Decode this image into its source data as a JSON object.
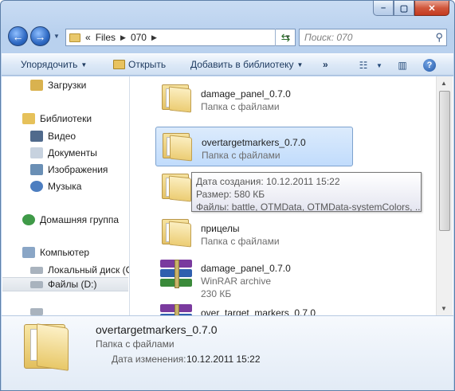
{
  "nav": {
    "breadcrumb_prefix": "«",
    "breadcrumb": [
      "Files",
      "070"
    ],
    "search_placeholder": "Поиск: 070"
  },
  "toolbar": {
    "organize": "Упорядочить",
    "open": "Открыть",
    "add_to_library": "Добавить в библиотеку",
    "more": "»"
  },
  "sidebar": {
    "items": [
      {
        "label": "Загрузки",
        "icon": "downloads-icon"
      },
      {
        "label": "Библиотеки",
        "icon": "libraries-icon"
      },
      {
        "label": "Видео",
        "icon": "video-icon"
      },
      {
        "label": "Документы",
        "icon": "documents-icon"
      },
      {
        "label": "Изображения",
        "icon": "pictures-icon"
      },
      {
        "label": "Музыка",
        "icon": "music-icon"
      },
      {
        "label": "Домашняя группа",
        "icon": "homegroup-icon"
      },
      {
        "label": "Компьютер",
        "icon": "computer-icon"
      },
      {
        "label": "Локальный диск (C",
        "icon": "drive-c-icon"
      },
      {
        "label": "Файлы (D:)",
        "icon": "drive-d-icon"
      }
    ]
  },
  "files": [
    {
      "name": "damage_panel_0.7.0",
      "type": "Папка с файлами",
      "size": ""
    },
    {
      "name": "overtargetmarkers_0.7.0",
      "type": "Папка с файлами",
      "size": ""
    },
    {
      "name": "",
      "type": "",
      "size": ""
    },
    {
      "name": "прицелы",
      "type": "Папка с файлами",
      "size": ""
    },
    {
      "name": "damage_panel_0.7.0",
      "type": "WinRAR archive",
      "size": "230 КБ"
    },
    {
      "name": "over_target_markers_0.7.0",
      "type": "",
      "size": ""
    }
  ],
  "tooltip": {
    "line1": "Дата создания: 10.12.2011 15:22",
    "line2": "Размер: 580 КБ",
    "line3": "Файлы: battle, OTMData, OTMData-systemColors, ..."
  },
  "details": {
    "name": "overtargetmarkers_0.7.0",
    "type": "Папка с файлами",
    "modified_label": "Дата изменения:",
    "modified_value": "10.12.2011 15:22"
  },
  "colors": {
    "selection_bg": "#c1dcfc",
    "selection_border": "#7da2ce",
    "frame": "#b9d1ee"
  }
}
